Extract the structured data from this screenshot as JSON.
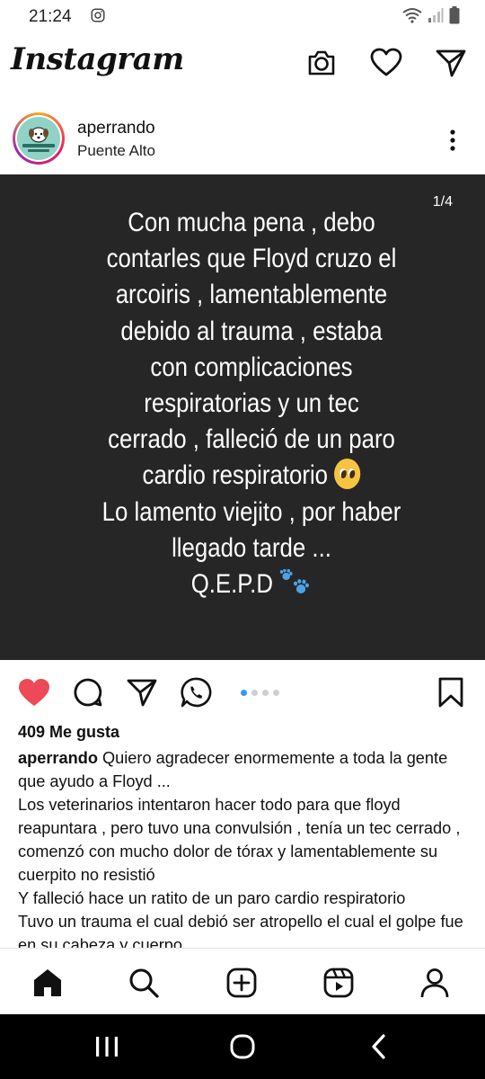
{
  "status": {
    "time": "21:24"
  },
  "app": {
    "logo": "Instagram"
  },
  "post": {
    "username": "aperrando",
    "location": "Puente Alto",
    "media_counter": "1/4",
    "story_lines": [
      "Con mucha pena , debo",
      "contarles que Floyd cruzo el",
      "arcoiris , lamentablemente",
      "debido al trauma , estaba",
      "con complicaciones",
      "respiratorias y un tec",
      "cerrado , falleció de un paro",
      "cardio respiratorio",
      "Lo lamento viejito , por haber",
      "llegado tarde ...",
      "Q.E.P.D"
    ],
    "carousel": {
      "total": 4,
      "active": 1
    },
    "likes": "409 Me gusta",
    "caption_user": "aperrando",
    "caption_first": " Quiero agradecer enormemente a toda la gente que ayudo a Floyd ...",
    "caption_lines": [
      "Los veterinarios intentaron hacer todo para que floyd reapuntara , pero tuvo una convulsión , tenía un tec cerrado , comenzó con mucho dolor de tórax y lamentablemente su cuerpito no resistió",
      "Y falleció hace un ratito de un paro cardio respiratorio",
      "Tuvo un trauma el cual debió ser atropello el cual el golpe fue en su cabeza y cuerpo"
    ],
    "icons": {
      "like": "heart-filled-icon",
      "comment": "comment-icon",
      "share": "send-icon",
      "whatsapp": "whatsapp-icon",
      "save": "bookmark-icon"
    }
  },
  "colors": {
    "like": "#ed4956",
    "media_bg": "#262626",
    "carousel_active": "#3897f0"
  }
}
